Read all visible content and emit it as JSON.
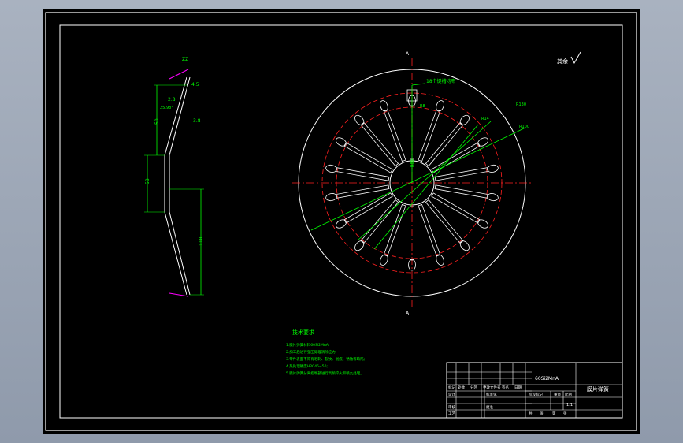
{
  "drawing": {
    "title": "膜片弹簧",
    "check_mark": "其余",
    "material": "60Si2MnA",
    "scale": "1:1"
  },
  "side_view": {
    "dims": [
      "4.5",
      "2.8",
      "25.98°",
      "3.8",
      "50",
      "58",
      "118",
      "ZZ"
    ]
  },
  "front_view": {
    "section_marks": [
      "A",
      "A"
    ],
    "labels": [
      "18个键槽均布",
      "R8",
      "R14",
      "R100",
      "R130",
      "R80"
    ]
  },
  "notes": {
    "heading": "技术要求",
    "lines": [
      "1.膜片弹簧材料60Si2MnA;",
      "2.加工后进行强压处理消除应力;",
      "3.零件表面不得有毛刺、裂纹、划痕、锈蚀等缺陷;",
      "4.热处理硬度HRC45~50;",
      "5.膜片弹簧分离指端部进行高频淬火和喷丸处理。"
    ]
  },
  "title_block": {
    "row_labels": [
      "标记",
      "设计",
      "审核",
      "工艺"
    ],
    "col_labels": [
      "处数",
      "分区",
      "更改文件号",
      "签名",
      "日期"
    ],
    "mid_labels": [
      "标准化",
      "批准"
    ],
    "right_labels": [
      "阶段标记",
      "重量",
      "比例",
      "共",
      "张",
      "第",
      "张"
    ]
  },
  "colors": {
    "background": "#000000",
    "outline": "#ffffff",
    "center_line": "#ff2020",
    "dimension": "#00ff00",
    "text": "#00ff00",
    "accent": "#ff00ff"
  }
}
